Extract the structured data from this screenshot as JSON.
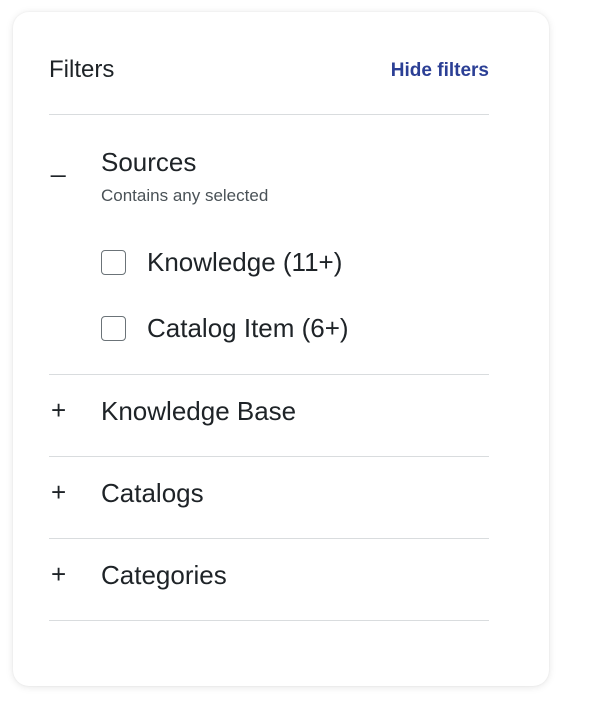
{
  "filters": {
    "title": "Filters",
    "hide_label": "Hide filters",
    "sections": [
      {
        "toggle": "_",
        "label": "Sources",
        "expanded": true,
        "subtext": "Contains any selected",
        "options": [
          {
            "label": "Knowledge (11+)",
            "checked": false
          },
          {
            "label": "Catalog Item (6+)",
            "checked": false
          }
        ]
      },
      {
        "toggle": "+",
        "label": "Knowledge Base",
        "expanded": false
      },
      {
        "toggle": "+",
        "label": "Catalogs",
        "expanded": false
      },
      {
        "toggle": "+",
        "label": "Categories",
        "expanded": false
      }
    ]
  },
  "colors": {
    "link": "#2b3f95",
    "text": "#1e2327",
    "divider": "#d9dcde"
  }
}
